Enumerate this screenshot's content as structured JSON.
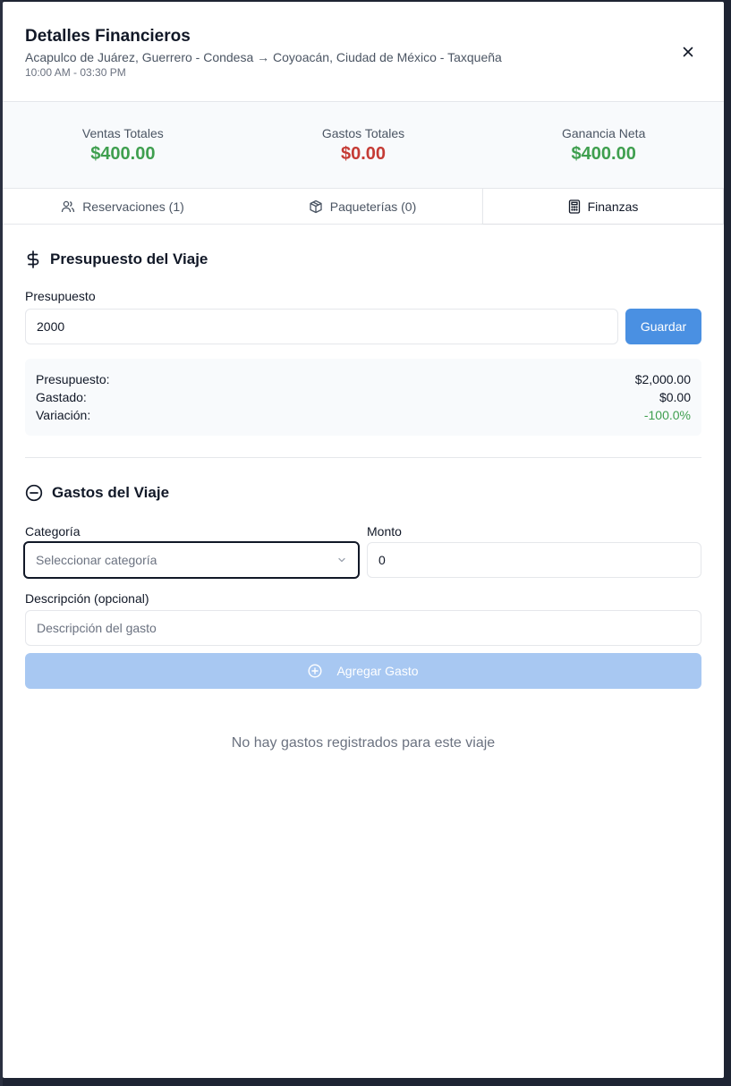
{
  "header": {
    "title": "Detalles Financieros",
    "route": "Acapulco de Juárez, Guerrero - Condesa → Coyoacán, Ciudad de México - Taxqueña",
    "time": "10:00 AM - 03:30 PM"
  },
  "summary": [
    {
      "label": "Ventas Totales",
      "value": "$400.00",
      "color": "#3f9f4f"
    },
    {
      "label": "Gastos Totales",
      "value": "$0.00",
      "color": "#c53b35"
    },
    {
      "label": "Ganancia Neta",
      "value": "$400.00",
      "color": "#3f9f4f"
    }
  ],
  "tabs": [
    {
      "label": "Reservaciones (1)",
      "icon": "users-icon"
    },
    {
      "label": "Paqueterías (0)",
      "icon": "package-icon"
    },
    {
      "label": "Finanzas",
      "icon": "calculator-icon",
      "active": true
    }
  ],
  "budget": {
    "section_title": "Presupuesto del Viaje",
    "label": "Presupuesto",
    "value": "2000",
    "save_label": "Guardar",
    "stats": [
      {
        "label": "Presupuesto:",
        "value": "$2,000.00"
      },
      {
        "label": "Gastado:",
        "value": "$0.00"
      },
      {
        "label": "Variación:",
        "value": "-100.0%",
        "color": "#3f9f4f"
      }
    ]
  },
  "expenses": {
    "section_title": "Gastos del Viaje",
    "category_label": "Categoría",
    "category_placeholder": "Seleccionar categoría",
    "amount_label": "Monto",
    "amount_value": "0",
    "description_label": "Descripción (opcional)",
    "description_placeholder": "Descripción del gasto",
    "add_label": "Agregar Gasto",
    "empty_message": "No hay gastos registrados para este viaje"
  },
  "colors": {
    "accent": "#4a90e2",
    "accent_disabled": "#a8c8f2",
    "positive": "#3f9f4f",
    "negative": "#c53b35"
  }
}
